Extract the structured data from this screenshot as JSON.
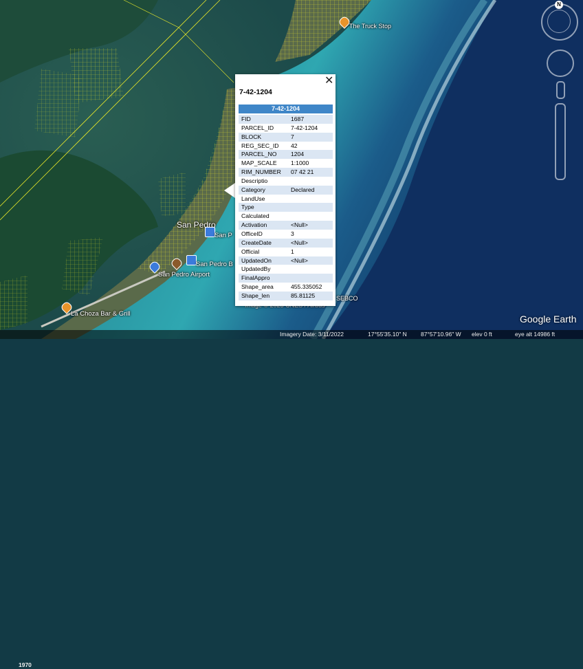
{
  "map": {
    "labels": {
      "town": "San Pedro",
      "airport": "San Pedro Airport",
      "truck_stop": "The Truck Stop",
      "la_choza": "La Choza Bar & Grill",
      "san_p_short": "San P",
      "san_pedro_b": "San Pedro B",
      "sebco": "SEBCO"
    },
    "copyright": "Image © 2023 CNES / Airbus"
  },
  "popup": {
    "title": "7-42-1204",
    "header": "7-42-1204",
    "close_label": "✕",
    "rows": [
      {
        "key": "FID",
        "value": "1687"
      },
      {
        "key": "PARCEL_ID",
        "value": "7-42-1204"
      },
      {
        "key": "BLOCK",
        "value": "7"
      },
      {
        "key": "REG_SEC_ID",
        "value": "42"
      },
      {
        "key": "PARCEL_NO",
        "value": "1204"
      },
      {
        "key": "MAP_SCALE",
        "value": "1:1000"
      },
      {
        "key": "RIM_NUMBER",
        "value": "07 42 21"
      },
      {
        "key": "Descriptio",
        "value": ""
      },
      {
        "key": "Category",
        "value": "Declared"
      },
      {
        "key": "LandUse",
        "value": ""
      },
      {
        "key": "Type",
        "value": ""
      },
      {
        "key": "Calculated",
        "value": ""
      },
      {
        "key": "Activation",
        "value": "<Null>"
      },
      {
        "key": "OfficeID",
        "value": "3"
      },
      {
        "key": "CreateDate",
        "value": "<Null>"
      },
      {
        "key": "Official",
        "value": "1"
      },
      {
        "key": "UpdatedOn",
        "value": "<Null>"
      },
      {
        "key": "UpdatedBy",
        "value": ""
      },
      {
        "key": "FinalAppro",
        "value": ""
      },
      {
        "key": "Shape_area",
        "value": "455.335052"
      },
      {
        "key": "Shape_len",
        "value": "85.81125"
      }
    ]
  },
  "nav": {
    "compass_label": "N"
  },
  "status": {
    "history_year": "1970",
    "imagery_date": "Imagery Date: 3/11/2022",
    "lat": "17°55'35.10\" N",
    "lon": "87°57'10.96\" W",
    "elev": "elev    0 ft",
    "eye_alt": "eye alt  14986 ft"
  },
  "brand": "Google Earth",
  "colors": {
    "parcel": "#e6e62a",
    "header": "#3f86c8",
    "row_alt": "#dbe6f3"
  }
}
